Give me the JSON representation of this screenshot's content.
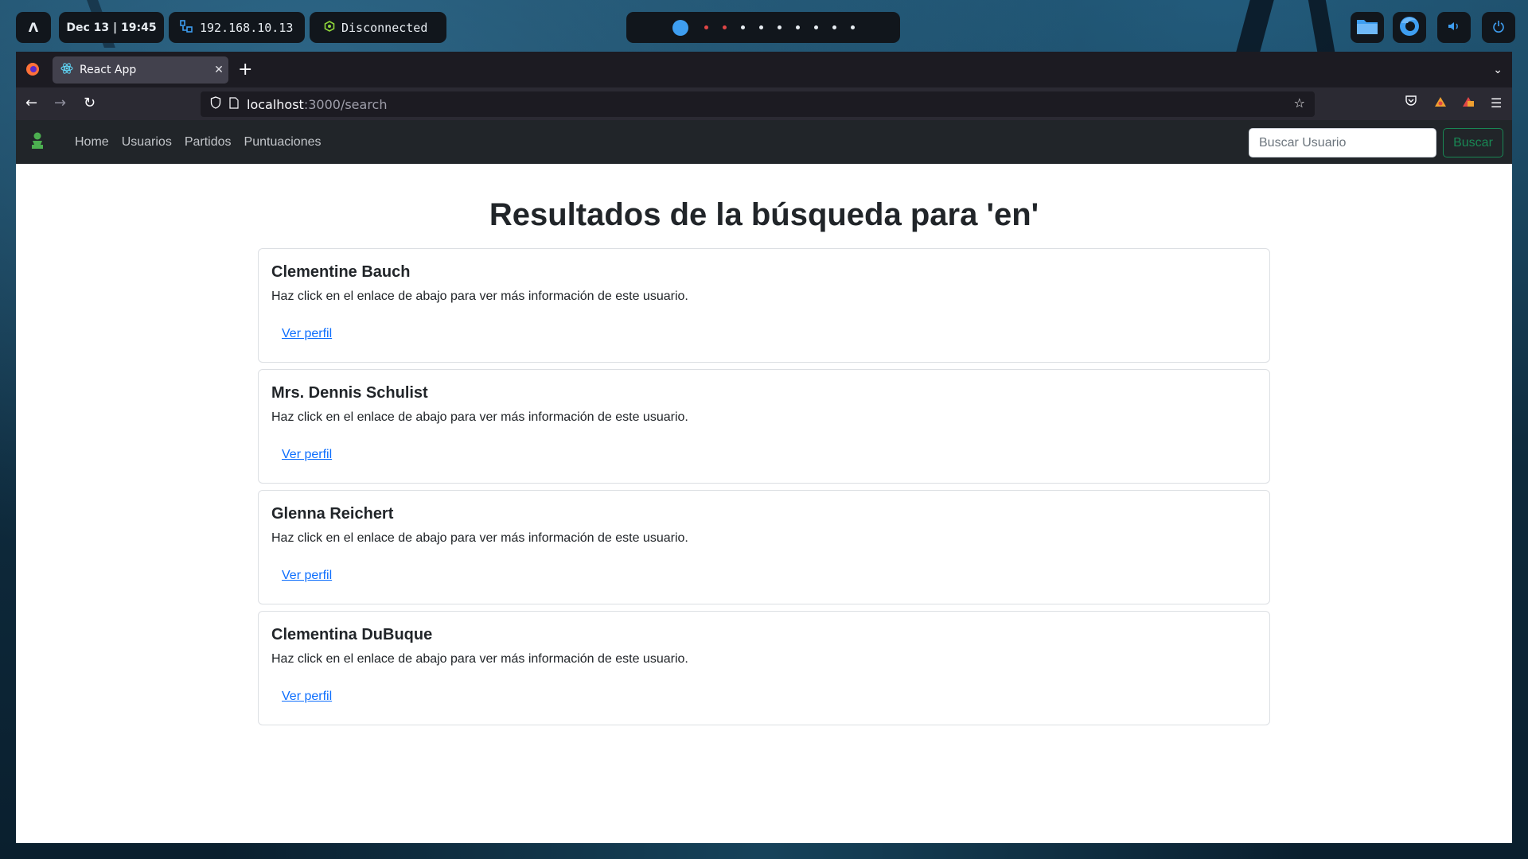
{
  "system_bar": {
    "launcher_label": "Λ",
    "clock": "Dec 13 | 19:45",
    "ip_address": "192.168.10.13",
    "vpn_status": "Disconnected",
    "workspace_count": 10,
    "active_workspace": 1
  },
  "browser": {
    "tab_title": "React App",
    "new_tab_label": "+",
    "url_host": "localhost",
    "url_path": ":3000/search"
  },
  "app_nav": {
    "links": [
      "Home",
      "Usuarios",
      "Partidos",
      "Puntuaciones"
    ],
    "search_placeholder": "Buscar Usuario",
    "search_button": "Buscar"
  },
  "results": {
    "title": "Resultados de la búsqueda para 'en'",
    "items": [
      {
        "name": "Clementine Bauch",
        "description": "Haz click en el enlace de abajo para ver más información de este usuario.",
        "link": "Ver perfil"
      },
      {
        "name": "Mrs. Dennis Schulist",
        "description": "Haz click en el enlace de abajo para ver más información de este usuario.",
        "link": "Ver perfil"
      },
      {
        "name": "Glenna Reichert",
        "description": "Haz click en el enlace de abajo para ver más información de este usuario.",
        "link": "Ver perfil"
      },
      {
        "name": "Clementina DuBuque",
        "description": "Haz click en el enlace de abajo para ver más información de este usuario.",
        "link": "Ver perfil"
      }
    ]
  },
  "colors": {
    "app_navbar": "#212529",
    "success": "#198754",
    "link": "#0d6efd",
    "workspace_active": "#3e9ef1"
  }
}
